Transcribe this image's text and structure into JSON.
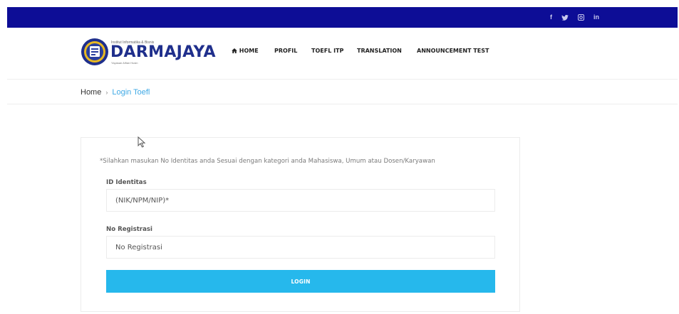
{
  "colors": {
    "topbar": "#0d0d96",
    "brand": "#1f2f8c",
    "accent": "#26b8ec",
    "link": "#3fa9e5"
  },
  "topbar": {
    "social": [
      {
        "icon": "facebook-icon",
        "glyph": "f"
      },
      {
        "icon": "twitter-icon",
        "glyph": "🐦"
      },
      {
        "icon": "instagram-icon",
        "glyph": "◙"
      },
      {
        "icon": "linkedin-icon",
        "glyph": "in"
      }
    ]
  },
  "logo": {
    "institute": "Institut Informatika & Bisnis",
    "name": "DARMAJAYA",
    "foundation": "Yayasan Alfian Husin"
  },
  "nav": {
    "home_icon": "home-icon",
    "home": "HOME",
    "profil": "PROFIL",
    "toefl": "TOEFL ITP",
    "translation": "TRANSLATION",
    "announcement": "ANNOUNCEMENT TEST"
  },
  "breadcrumb": {
    "home": "Home",
    "separator": "›",
    "current": "Login Toefl"
  },
  "form": {
    "info": "*Silahkan masukan No Identitas anda Sesuai dengan kategori anda Mahasiswa, Umum atau Dosen/Karyawan",
    "id_label": "ID Identitas",
    "id_placeholder": "(NIK/NPM/NIP)*",
    "reg_label": "No Registrasi",
    "reg_placeholder": "No Registrasi",
    "login_label": "LOGIN"
  }
}
